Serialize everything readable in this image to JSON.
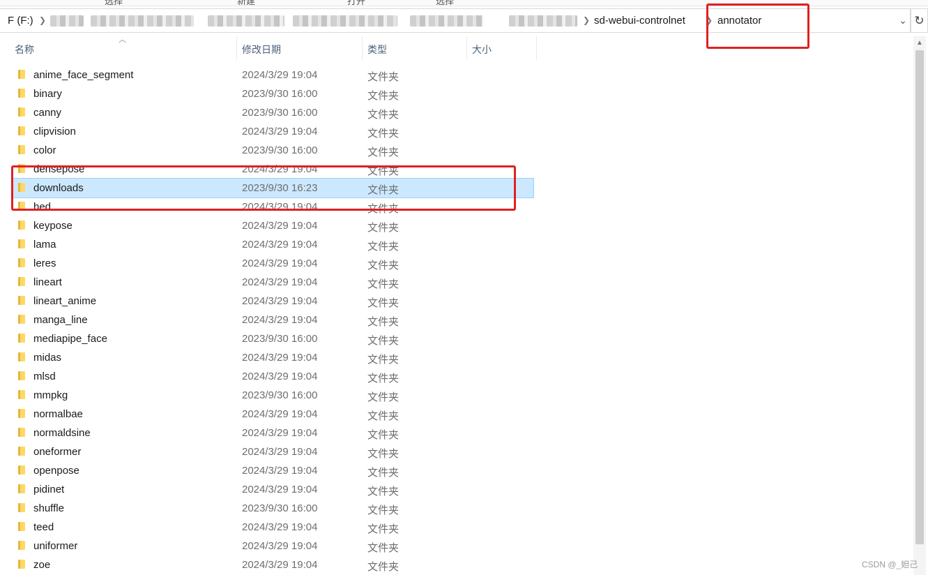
{
  "ribbon": {
    "tabs": [
      "选择",
      "新建",
      "打开",
      "选择"
    ]
  },
  "address": {
    "drive": "F (F:)",
    "crumbs": [
      "sd-webui-controlnet",
      "annotator"
    ]
  },
  "columns": {
    "name": "名称",
    "modified": "修改日期",
    "type": "类型",
    "size": "大小"
  },
  "files": [
    {
      "name": "anime_face_segment",
      "date": "2024/3/29 19:04",
      "type": "文件夹"
    },
    {
      "name": "binary",
      "date": "2023/9/30 16:00",
      "type": "文件夹"
    },
    {
      "name": "canny",
      "date": "2023/9/30 16:00",
      "type": "文件夹"
    },
    {
      "name": "clipvision",
      "date": "2024/3/29 19:04",
      "type": "文件夹"
    },
    {
      "name": "color",
      "date": "2023/9/30 16:00",
      "type": "文件夹"
    },
    {
      "name": "densepose",
      "date": "2024/3/29 19:04",
      "type": "文件夹"
    },
    {
      "name": "downloads",
      "date": "2023/9/30 16:23",
      "type": "文件夹",
      "selected": true
    },
    {
      "name": "hed",
      "date": "2024/3/29 19:04",
      "type": "文件夹"
    },
    {
      "name": "keypose",
      "date": "2024/3/29 19:04",
      "type": "文件夹"
    },
    {
      "name": "lama",
      "date": "2024/3/29 19:04",
      "type": "文件夹"
    },
    {
      "name": "leres",
      "date": "2024/3/29 19:04",
      "type": "文件夹"
    },
    {
      "name": "lineart",
      "date": "2024/3/29 19:04",
      "type": "文件夹"
    },
    {
      "name": "lineart_anime",
      "date": "2024/3/29 19:04",
      "type": "文件夹"
    },
    {
      "name": "manga_line",
      "date": "2024/3/29 19:04",
      "type": "文件夹"
    },
    {
      "name": "mediapipe_face",
      "date": "2023/9/30 16:00",
      "type": "文件夹"
    },
    {
      "name": "midas",
      "date": "2024/3/29 19:04",
      "type": "文件夹"
    },
    {
      "name": "mlsd",
      "date": "2024/3/29 19:04",
      "type": "文件夹"
    },
    {
      "name": "mmpkg",
      "date": "2023/9/30 16:00",
      "type": "文件夹"
    },
    {
      "name": "normalbae",
      "date": "2024/3/29 19:04",
      "type": "文件夹"
    },
    {
      "name": "normaldsine",
      "date": "2024/3/29 19:04",
      "type": "文件夹"
    },
    {
      "name": "oneformer",
      "date": "2024/3/29 19:04",
      "type": "文件夹"
    },
    {
      "name": "openpose",
      "date": "2024/3/29 19:04",
      "type": "文件夹"
    },
    {
      "name": "pidinet",
      "date": "2024/3/29 19:04",
      "type": "文件夹"
    },
    {
      "name": "shuffle",
      "date": "2023/9/30 16:00",
      "type": "文件夹"
    },
    {
      "name": "teed",
      "date": "2024/3/29 19:04",
      "type": "文件夹"
    },
    {
      "name": "uniformer",
      "date": "2024/3/29 19:04",
      "type": "文件夹"
    },
    {
      "name": "zoe",
      "date": "2024/3/29 19:04",
      "type": "文件夹"
    }
  ],
  "watermark": "CSDN @_妲己",
  "colors": {
    "selection": "#cce8ff",
    "highlight": "#e02020",
    "folder": "#fcd86a"
  }
}
